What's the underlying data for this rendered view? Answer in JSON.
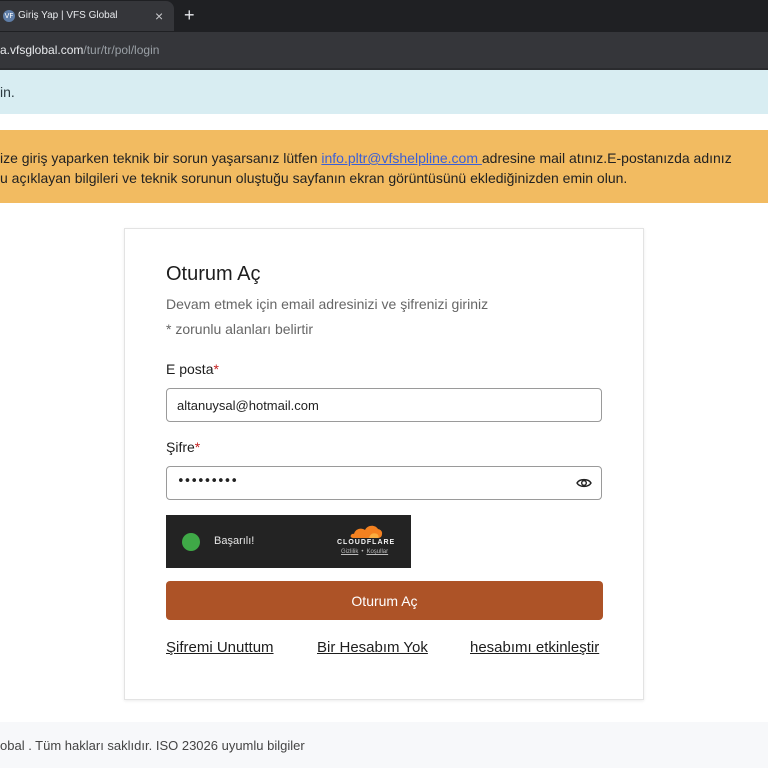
{
  "browser": {
    "tab_title": "Giriş Yap | VFS Global",
    "favicon_text": "VF",
    "close_glyph": "×",
    "new_tab_glyph": "+",
    "url_host": "a.vfsglobal.com",
    "url_path": "/tur/tr/pol/login"
  },
  "info_banner": {
    "text": "in."
  },
  "warning_banner": {
    "line1_before": "ize giriş yaparken teknik bir sorun yaşarsanız lütfen ",
    "email": "info.pltr@vfshelpline.com ",
    "line1_after": "adresine mail atınız.E-postanızda adınız",
    "line2": "u açıklayan bilgileri ve teknik sorunun oluştuğu sayfanın ekran görüntüsünü eklediğinizden emin olun."
  },
  "login": {
    "title": "Oturum Aç",
    "subtitle": "Devam etmek için email adresinizi ve şifrenizi giriniz",
    "required_note": "* zorunlu alanları belirtir",
    "email_label": "E posta",
    "email_value": "altanuysal@hotmail.com",
    "password_label": "Şifre",
    "password_mask": "•••••••••",
    "required_mark": "*",
    "submit_label": "Oturum Aç",
    "links": {
      "forgot": "Şifremi Unuttum",
      "no_account": "Bir Hesabım Yok",
      "activate": "hesabımı etkinleştir"
    }
  },
  "captcha": {
    "status": "Başarılı!",
    "brand": "CLOUDFLARE",
    "privacy": "Gizlilik",
    "separator": "•",
    "terms": "Koşullar"
  },
  "footer": {
    "text": "obal . Tüm hakları saklıdır. ISO 23026 uyumlu bilgiler"
  },
  "colors": {
    "accent_button": "#ad5327",
    "warning_bg": "#f2bb61",
    "info_bg": "#d8edf2",
    "link": "#3b5fd6",
    "success": "#3fa947"
  },
  "icons": [
    "vfs-favicon-icon",
    "close-icon",
    "plus-icon",
    "eye-icon",
    "checkmark-icon",
    "cloudflare-logo-icon"
  ]
}
